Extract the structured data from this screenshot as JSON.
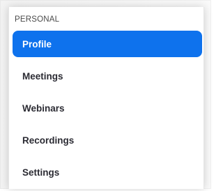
{
  "sidebar": {
    "section_title": "PERSONAL",
    "items": [
      {
        "label": "Profile",
        "active": true
      },
      {
        "label": "Meetings",
        "active": false
      },
      {
        "label": "Webinars",
        "active": false
      },
      {
        "label": "Recordings",
        "active": false
      },
      {
        "label": "Settings",
        "active": false
      }
    ],
    "colors": {
      "active_bg": "#0e72ed",
      "active_text": "#ffffff",
      "text": "#2b2b33",
      "section_title": "#4a4a4a"
    }
  }
}
